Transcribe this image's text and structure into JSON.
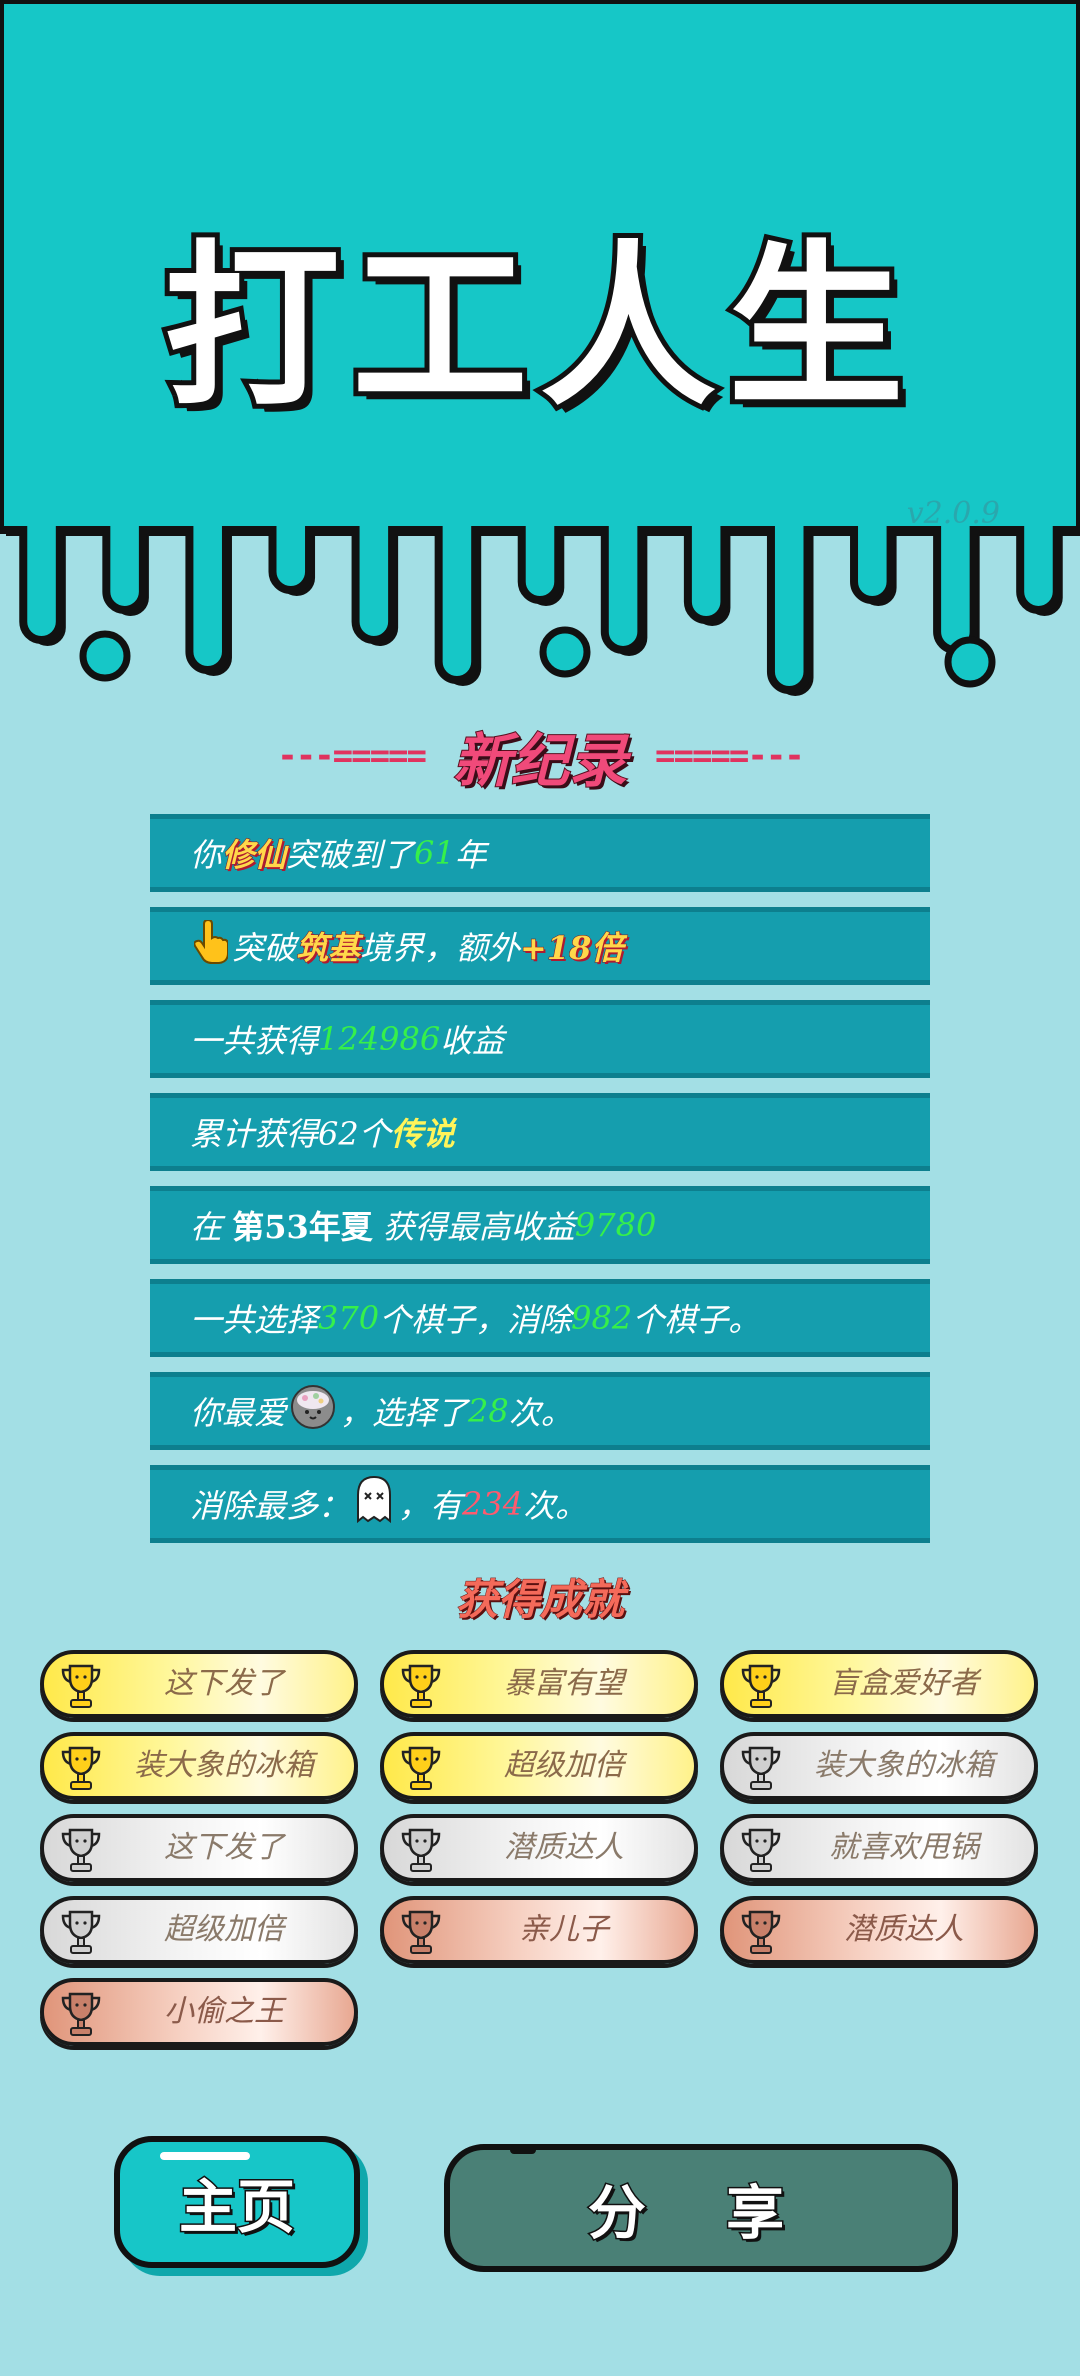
{
  "header": {
    "title": "打工人生",
    "version": "v2.0.9"
  },
  "record": {
    "title": "新纪录",
    "deco_left": "---=====",
    "deco_right": "=====---"
  },
  "stats": [
    {
      "pre": "你",
      "tag": "修仙",
      "mid": "突破到了",
      "num": "61",
      "post": "年"
    },
    {
      "pre": "突破",
      "tag": "筑基",
      "mid": "境界，额外",
      "num": "+18倍",
      "icon": "pointing-hand-icon"
    },
    {
      "pre": "一共获得",
      "num": "124986",
      "post": "收益"
    },
    {
      "pre": "累计获得62个",
      "num": "传说"
    },
    {
      "pre": "在",
      "bold": "第53年夏",
      "mid": "获得最高收益",
      "num": "9780"
    },
    {
      "pre": "一共选择",
      "num": "370",
      "mid": "个棋子，消除",
      "num2": "982",
      "post": "个棋子。"
    },
    {
      "pre": "你最爱",
      "icon": "rice-ball-icon",
      "mid": "，选择了",
      "num": "28",
      "post": "次。"
    },
    {
      "pre": "消除最多：",
      "icon": "ghost-icon",
      "mid": "，有",
      "num": "234",
      "post": "次。"
    }
  ],
  "achievements": {
    "title": "获得成就",
    "items": [
      {
        "label": "这下发了",
        "tier": "gold"
      },
      {
        "label": "暴富有望",
        "tier": "gold"
      },
      {
        "label": "盲盒爱好者",
        "tier": "gold"
      },
      {
        "label": "装大象的冰箱",
        "tier": "gold"
      },
      {
        "label": "超级加倍",
        "tier": "gold"
      },
      {
        "label": "装大象的冰箱",
        "tier": "silver"
      },
      {
        "label": "这下发了",
        "tier": "silver"
      },
      {
        "label": "潜质达人",
        "tier": "silver"
      },
      {
        "label": "就喜欢甩锅",
        "tier": "silver"
      },
      {
        "label": "超级加倍",
        "tier": "silver"
      },
      {
        "label": "亲儿子",
        "tier": "bronze"
      },
      {
        "label": "潜质达人",
        "tier": "bronze"
      },
      {
        "label": "小偷之王",
        "tier": "bronze"
      }
    ]
  },
  "buttons": {
    "home": "主页",
    "share": "分 享"
  },
  "colors": {
    "top_bg": "#16c7c7",
    "page_bg": "#a3dfe5",
    "stat_row": "#159eae",
    "highlight_green": "#36f04a",
    "highlight_red": "#ff5a6e",
    "highlight_yellow": "#fff45a"
  }
}
